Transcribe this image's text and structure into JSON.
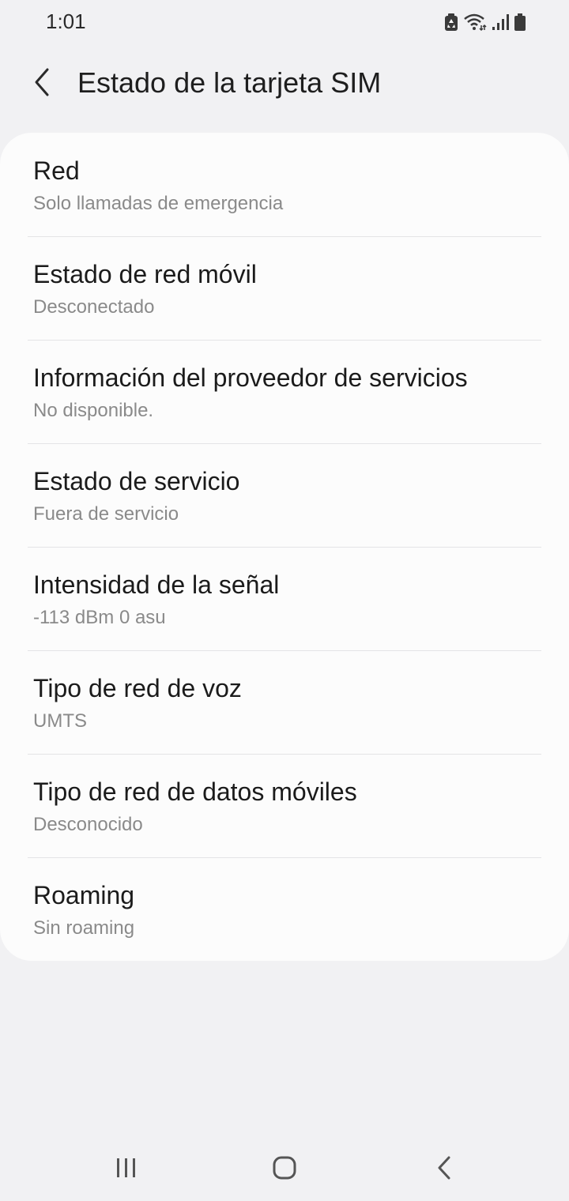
{
  "status_bar": {
    "time": "1:01",
    "icons": [
      "recycle-notification-icon",
      "wifi-icon",
      "cellular-signal-icon",
      "battery-icon"
    ]
  },
  "header": {
    "back_icon": "chevron-left-icon",
    "title": "Estado de la tarjeta SIM"
  },
  "items": [
    {
      "title": "Red",
      "subtitle": "Solo llamadas de emergencia"
    },
    {
      "title": "Estado de red móvil",
      "subtitle": "Desconectado"
    },
    {
      "title": "Información del proveedor de servicios",
      "subtitle": "No disponible."
    },
    {
      "title": "Estado de servicio",
      "subtitle": "Fuera de servicio"
    },
    {
      "title": "Intensidad de la señal",
      "subtitle": "-113 dBm 0 asu"
    },
    {
      "title": "Tipo de red de voz",
      "subtitle": "UMTS"
    },
    {
      "title": "Tipo de red de datos móviles",
      "subtitle": "Desconocido"
    },
    {
      "title": "Roaming",
      "subtitle": "Sin roaming"
    }
  ],
  "nav_bar": {
    "icons": [
      "recent-apps-icon",
      "home-icon",
      "back-icon"
    ]
  },
  "colors": {
    "background": "#f1f1f3",
    "card": "#fcfcfc",
    "title_text": "#1b1b1b",
    "subtitle_text": "#8a8a8a",
    "divider": "#e4e4e6"
  }
}
